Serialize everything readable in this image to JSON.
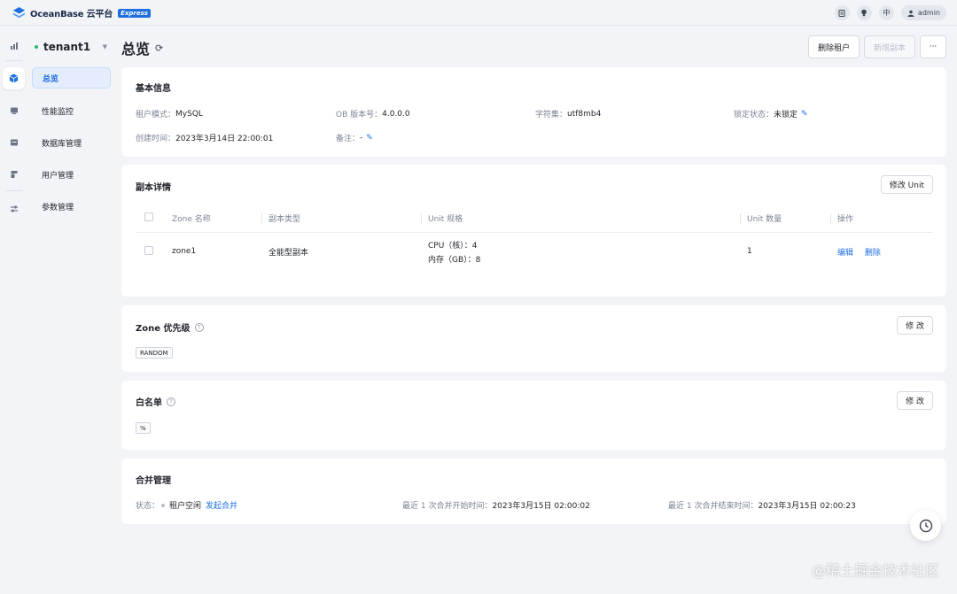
{
  "brand": {
    "name": "OceanBase 云平台",
    "badge": "Express"
  },
  "topbar": {
    "lang": "中",
    "user": "admin"
  },
  "tenant": {
    "name": "tenant1"
  },
  "menu": [
    "总览",
    "性能监控",
    "数据库管理",
    "用户管理",
    "参数管理"
  ],
  "page": {
    "title": "总览",
    "delete_tenant": "删除租户",
    "add_replica": "新增副本",
    "more": "···"
  },
  "basic": {
    "title": "基本信息",
    "mode_label": "租户模式：",
    "mode_value": "MySQL",
    "ob_label": "OB 版本号：",
    "ob_value": "4.0.0.0",
    "charset_label": "字符集：",
    "charset_value": "utf8mb4",
    "lock_label": "锁定状态：",
    "lock_value": "未锁定",
    "created_label": "创建时间：",
    "created_value": "2023年3月14日 22:00:01",
    "remark_label": "备注：",
    "remark_value": "-"
  },
  "replica": {
    "title": "副本详情",
    "modify_unit": "修改 Unit",
    "columns": [
      "Zone 名称",
      "副本类型",
      "Unit 规格",
      "Unit 数量",
      "操作"
    ],
    "rows": [
      {
        "zone": "zone1",
        "type": "全能型副本",
        "cpu": "CPU（核）：4",
        "mem": "内存（GB）：8",
        "count": "1",
        "edit": "编辑",
        "delete": "删除"
      }
    ]
  },
  "zone_priority": {
    "title": "Zone 优先级",
    "button": "修 改",
    "tag": "RANDOM"
  },
  "whitelist": {
    "title": "白名单",
    "button": "修 改",
    "tag": "%"
  },
  "merge": {
    "title": "合并管理",
    "status_label": "状态：",
    "status_value": "租户空闲",
    "status_action": "发起合并",
    "start_label": "最近 1 次合并开始时间：",
    "start_value": "2023年3月15日 02:00:02",
    "end_label": "最近 1 次合并结束时间：",
    "end_value": "2023年3月15日 02:00:23"
  },
  "watermark": "@稀土掘金技术社区",
  "colors": {
    "primary": "#1e6fe0",
    "success": "#2bb673",
    "background": "#f2f4f7"
  }
}
